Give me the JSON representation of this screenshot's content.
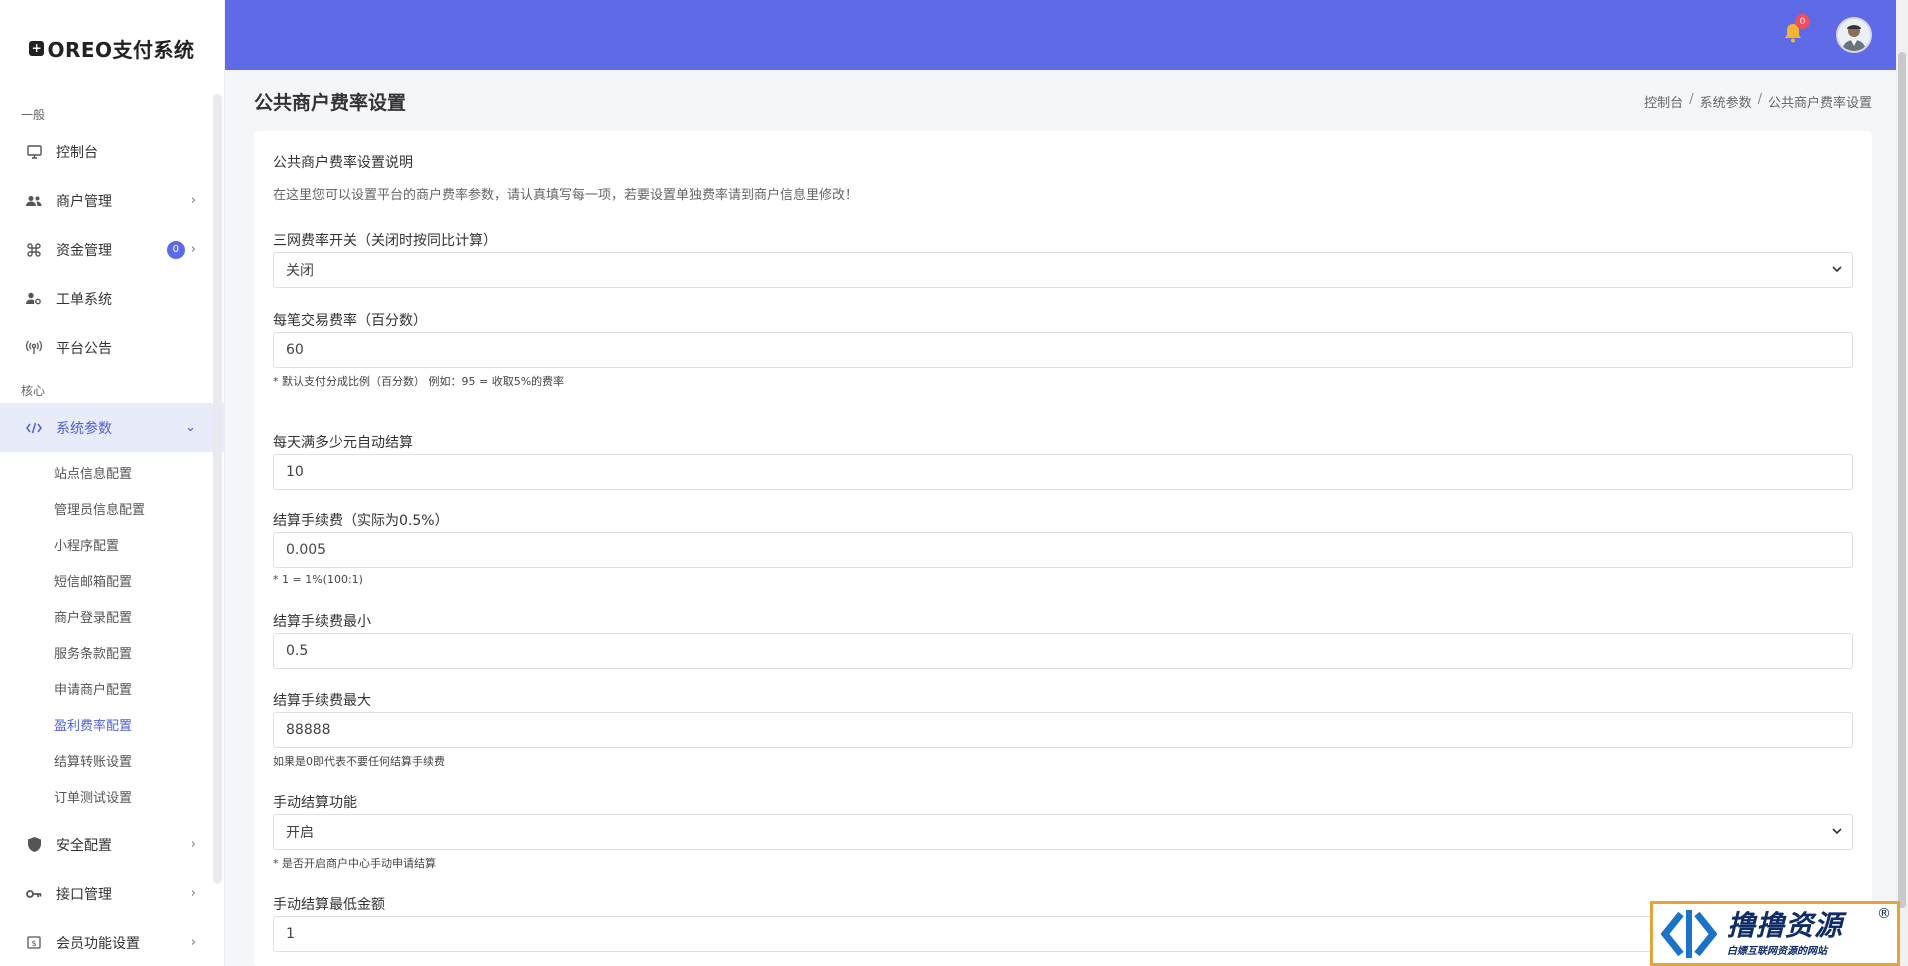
{
  "brand": {
    "name": "OREO支付系统",
    "icon": "plus-square-icon"
  },
  "sidebar": {
    "section_general": "一般",
    "section_core": "核心",
    "items": [
      {
        "label": "控制台",
        "icon": "monitor-icon"
      },
      {
        "label": "商户管理",
        "icon": "users-icon"
      },
      {
        "label": "资金管理",
        "icon": "command-icon",
        "badge": "0"
      },
      {
        "label": "工单系统",
        "icon": "user-cog-icon"
      },
      {
        "label": "平台公告",
        "icon": "broadcast-icon"
      }
    ],
    "active_item": {
      "label": "系统参数",
      "icon": "code-icon"
    },
    "sub_items": [
      "站点信息配置",
      "管理员信息配置",
      "小程序配置",
      "短信邮箱配置",
      "商户登录配置",
      "服务条款配置",
      "申请商户配置",
      "盈利费率配置",
      "结算转账设置",
      "订单测试设置"
    ],
    "bottom_items": [
      {
        "label": "安全配置",
        "icon": "shield-icon"
      },
      {
        "label": "接口管理",
        "icon": "key-icon"
      },
      {
        "label": "会员功能设置",
        "icon": "dollar-box-icon"
      }
    ]
  },
  "header": {
    "notification_count": "0"
  },
  "page": {
    "title": "公共商户费率设置",
    "breadcrumb": [
      "控制台",
      "系统参数",
      "公共商户费率设置"
    ]
  },
  "card": {
    "title": "公共商户费率设置说明",
    "description": "在这里您可以设置平台的商户费率参数，请认真填写每一项，若要设置单独费率请到商户信息里修改！"
  },
  "form": {
    "three_net_label": "三网费率开关（关闭时按同比计算）",
    "three_net_value": "关闭",
    "fee_rate_label": "每笔交易费率（百分数）",
    "fee_rate_value": "60",
    "fee_rate_help": "* 默认支付分成比例（百分数） 例如：95 = 收取5%的费率",
    "auto_settle_label": "每天满多少元自动结算",
    "auto_settle_value": "10",
    "settle_fee_label": "结算手续费（实际为0.5%）",
    "settle_fee_value": "0.005",
    "settle_fee_help": "* 1 = 1%(100:1)",
    "settle_min_label": "结算手续费最小",
    "settle_min_value": "0.5",
    "settle_max_label": "结算手续费最大",
    "settle_max_value": "88888",
    "settle_max_help": "如果是0即代表不要任何结算手续费",
    "manual_settle_label": "手动结算功能",
    "manual_settle_value": "开启",
    "manual_settle_help": "* 是否开启商户中心手动申请结算",
    "manual_min_label": "手动结算最低金额",
    "manual_min_value": "1"
  },
  "watermark": {
    "main": "撸撸资源",
    "sub": "白嫖互联网资源的网站",
    "reg": "®"
  },
  "colors": {
    "accent": "#5e6ae6",
    "active_text": "#4f5fd9",
    "badge_red": "#f44c5c"
  }
}
